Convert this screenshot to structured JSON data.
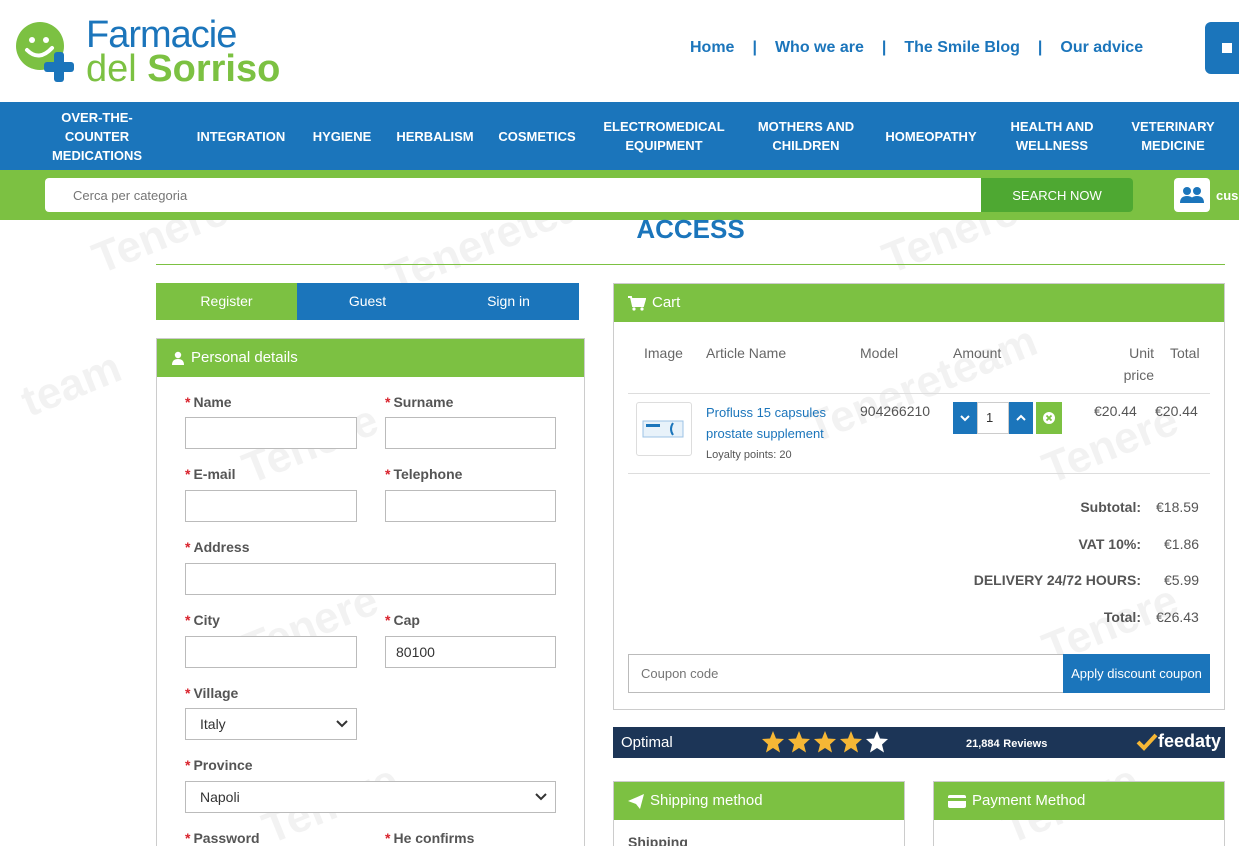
{
  "header": {
    "logo_line1": "Farmacie",
    "logo_line2_a": "del ",
    "logo_line2_b": "Sorriso",
    "nav": [
      "Home",
      "Who we are",
      "The Smile Blog",
      "Our advice"
    ],
    "nav_sep": "|"
  },
  "categories": [
    "OVER-THE-COUNTER MEDICATIONS",
    "INTEGRATION",
    "HYGIENE",
    "HERBALISM",
    "COSMETICS",
    "ELECTROMEDICAL EQUIPMENT",
    "MOTHERS AND CHILDREN",
    "HOMEOPATHY",
    "HEALTH AND WELLNESS",
    "VETERINARY MEDICINE"
  ],
  "search": {
    "placeholder": "Cerca per categoria",
    "button": "SEARCH NOW",
    "user_label": "cus"
  },
  "access_title": "ACCESS",
  "tabs": [
    "Register",
    "Guest",
    "Sign in"
  ],
  "personal": {
    "title": "Personal details",
    "required_mark": "*",
    "name_label": "Name",
    "surname_label": "Surname",
    "email_label": "E-mail",
    "telephone_label": "Telephone",
    "address_label": "Address",
    "city_label": "City",
    "cap_label": "Cap",
    "cap_value": "80100",
    "village_label": "Village",
    "village_value": "Italy",
    "province_label": "Province",
    "province_value": "Napoli",
    "password_label": "Password",
    "confirm_label": "He confirms"
  },
  "cart": {
    "title": "Cart",
    "headers": {
      "image": "Image",
      "article": "Article Name",
      "model": "Model",
      "amount": "Amount",
      "unit_price": "Unit price",
      "total": "Total"
    },
    "item": {
      "name": "Profluss 15 capsules prostate supplement",
      "loyalty": "Loyalty points: 20",
      "model": "904266210",
      "qty": "1",
      "unit_price": "€20.44",
      "total": "€20.44"
    },
    "summary": [
      {
        "label": "Subtotal:",
        "value": "€18.59"
      },
      {
        "label": "VAT 10%:",
        "value": "€1.86"
      },
      {
        "label": "DELIVERY 24/72 HOURS:",
        "value": "€5.99"
      },
      {
        "label": "Total:",
        "value": "€26.43"
      }
    ],
    "coupon_placeholder": "Coupon code",
    "coupon_button": "Apply discount coupon"
  },
  "feedaty": {
    "rating_text": "Optimal",
    "stars": 4,
    "reviews_count": "21,884",
    "reviews_word": "Reviews",
    "brand": "feedaty"
  },
  "shipping": {
    "title": "Shipping method",
    "label": "Shipping"
  },
  "payment": {
    "title": "Payment Method"
  },
  "colors": {
    "blue": "#1b75bb",
    "green": "#7cc142",
    "navy": "#1c3557"
  }
}
